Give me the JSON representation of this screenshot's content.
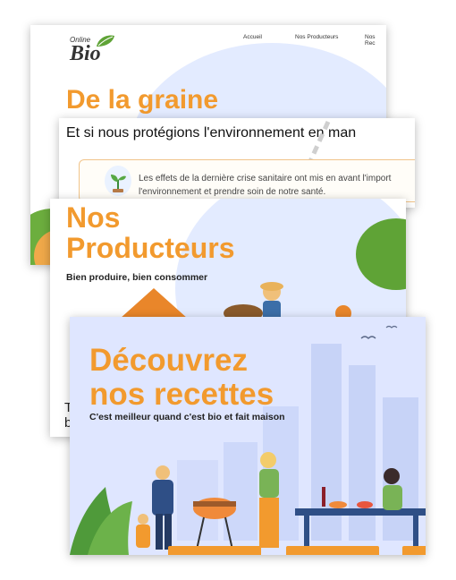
{
  "site": {
    "logo_small": "Online",
    "logo_big": "Bio",
    "nav": [
      "Accueil",
      "Nos Producteurs",
      "Nos Rec"
    ]
  },
  "card1": {
    "title": "De la graine"
  },
  "card2": {
    "question": "Et si nous protégions l'environnement en man",
    "info_line1": "Les effets de la dernière crise sanitaire ont mis en avant l'import",
    "info_line2": "l'environnement et prendre soin de notre santé."
  },
  "card3": {
    "title_line1": "Nos",
    "title_line2": "Producteurs",
    "subtitle": "Bien produire, bien consommer",
    "side_text": "T\nb"
  },
  "card4": {
    "title_line1": "Découvrez",
    "title_line2": "nos recettes",
    "subtitle": "C'est meilleur quand c'est bio et fait maison"
  },
  "colors": {
    "accent": "#f29a2e",
    "sky": "#dde6ff",
    "green": "#4e9a3b"
  }
}
